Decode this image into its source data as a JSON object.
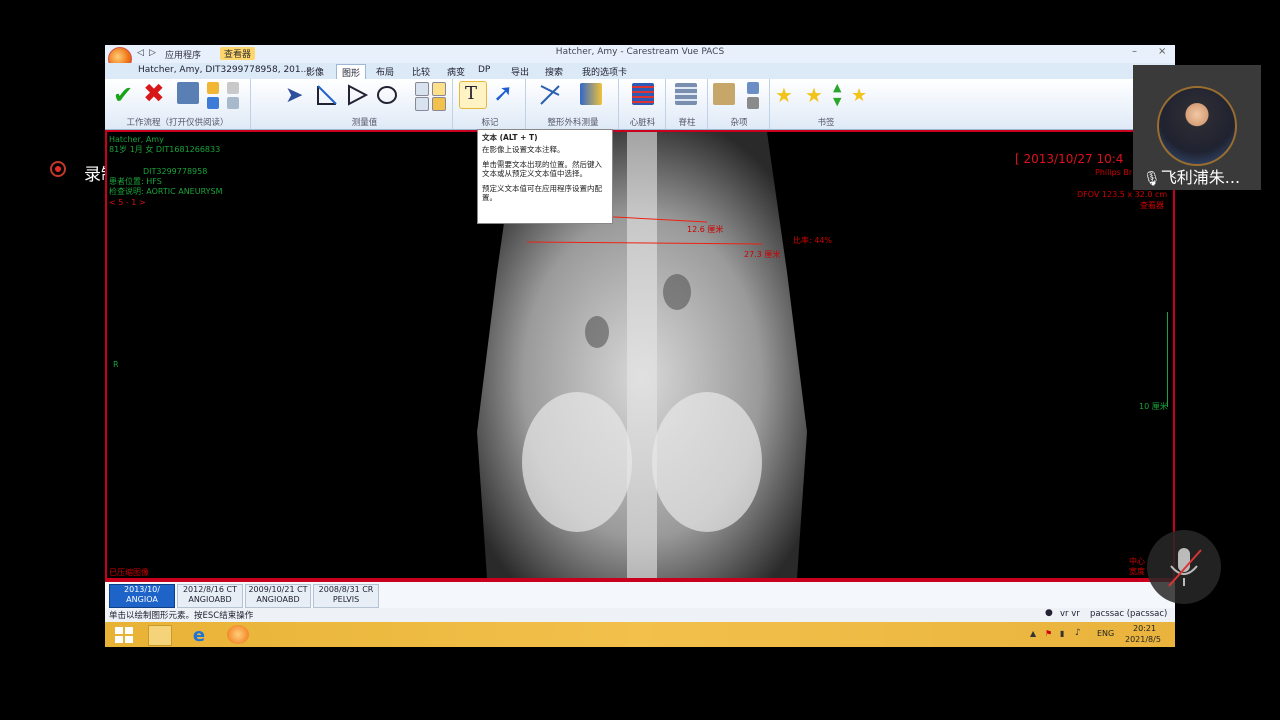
{
  "recording": {
    "label": "录制中"
  },
  "camera": {
    "name": "飞利浦朱..."
  },
  "window": {
    "title": "Hatcher, Amy - Carestream Vue PACS",
    "app_menu": "应用程序",
    "viewer_tag": "查看器"
  },
  "menubar": {
    "patient": "Hatcher, Amy, DIT3299778958, 201...",
    "items": [
      "影像",
      "图形",
      "布局",
      "比较",
      "病变",
      "DP",
      "导出",
      "搜索",
      "我的选项卡"
    ]
  },
  "ribbon": {
    "groups": [
      {
        "label": "工作流程（打开仅供阅读）"
      },
      {
        "label": "测量值"
      },
      {
        "label": "标记"
      },
      {
        "label": "整形外科测量"
      },
      {
        "label": "心脏科"
      },
      {
        "label": "脊柱"
      },
      {
        "label": "杂项"
      },
      {
        "label": "书签"
      }
    ]
  },
  "tooltip": {
    "title": "文本 (ALT + T)",
    "line1": "在影像上设置文本注释。",
    "line2": "单击需要文本出现的位置。然后键入文本或从预定义文本值中选择。",
    "line3": "预定义文本值可在应用程序设置内配置。"
  },
  "overlay": {
    "name": "Hatcher, Amy",
    "age": "81岁 1月 女 DIT1681266833",
    "id": "DIT3299778958",
    "position": "患者位置: HFS",
    "exam": "检查说明: AORTIC ANEURYSM",
    "series_nav": "< 5 - 1 >",
    "orient_left": "R",
    "datetime": "[ 2013/10/27 10:4",
    "vendor": "Philips Br",
    "dfov": "DFOV 123.5 x 32.0 cm",
    "viewer": "查看器",
    "scale": "10 厘米",
    "center": "中心",
    "window": "宽度",
    "measure1": "12.6 厘米",
    "measure2": "27.3 厘米",
    "ratio": "比率: 44%",
    "compressed": "已压缩图像"
  },
  "series": [
    {
      "date": "2013/10/",
      "name": "ANGIOA"
    },
    {
      "date": "2012/8/16 CT",
      "name": "ANGIOABD"
    },
    {
      "date": "2009/10/21 CT",
      "name": "ANGIOABD"
    },
    {
      "date": "2008/8/31 CR",
      "name": "PELVIS"
    }
  ],
  "status": {
    "message": "单击以绘制图形元素。按ESC结束操作",
    "user": "vr vr",
    "server": "pacssac (pacssac)"
  },
  "taskbar": {
    "lang": "ENG",
    "time": "20:21",
    "date": "2021/8/5"
  },
  "colors": {
    "accent_red": "#c8001e",
    "overlay_green": "#1aa33a",
    "taskbar": "#f2c14b"
  }
}
